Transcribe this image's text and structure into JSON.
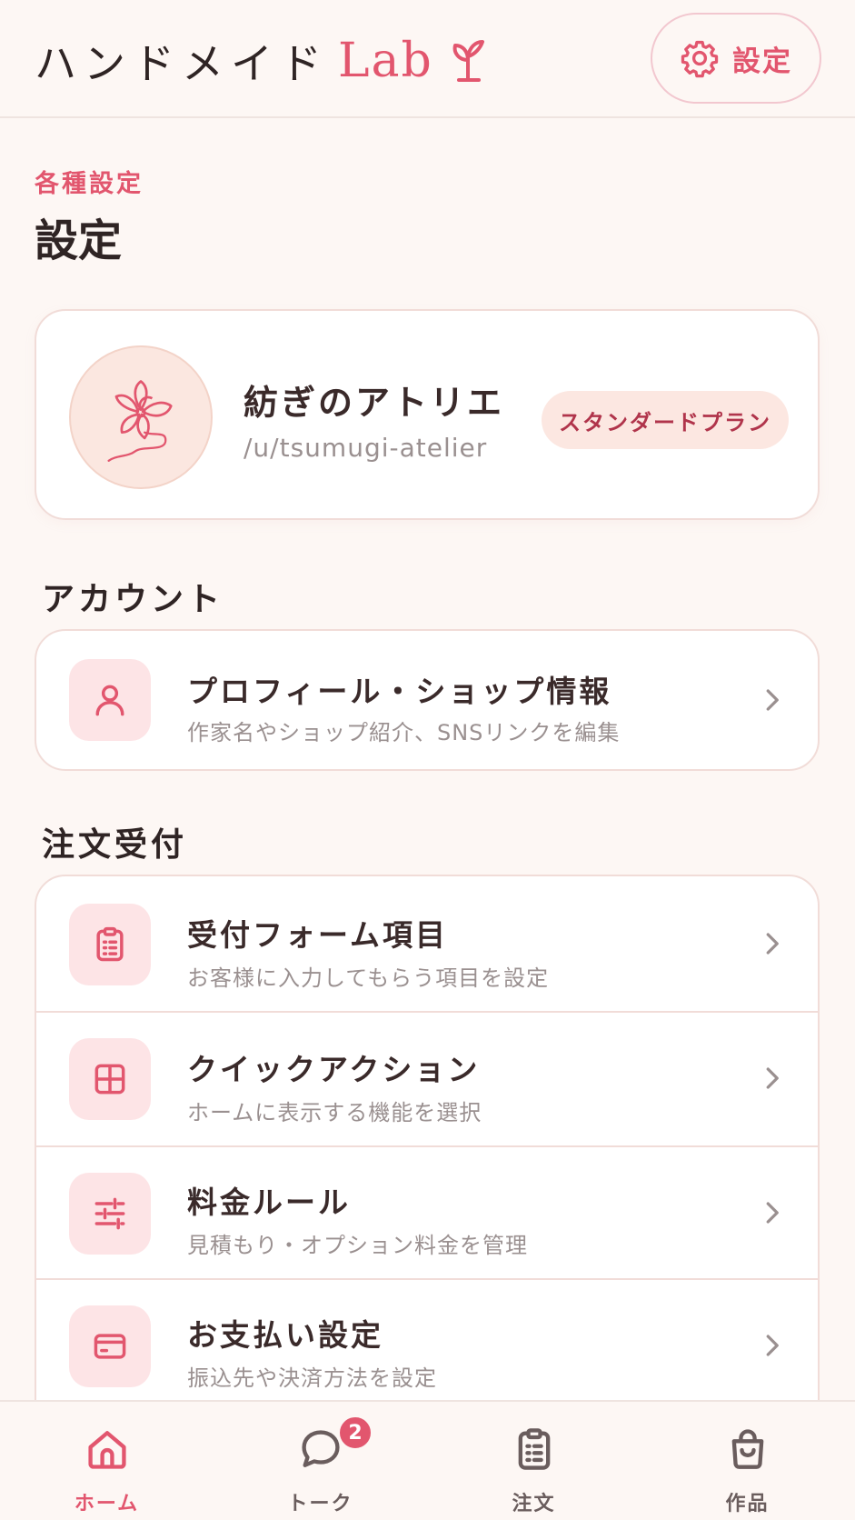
{
  "header": {
    "brand_jp": "ハンドメイド",
    "brand_lab": "Lab",
    "brand_icon": "sprout-icon",
    "settings_label": "設定",
    "settings_icon": "gear-icon"
  },
  "page": {
    "eyebrow": "各種設定",
    "title": "設定"
  },
  "profile": {
    "shop_name": "紡ぎのアトリエ",
    "handle": "/u/tsumugi-atelier",
    "plan": "スタンダードプラン",
    "avatar_icon": "sakura-flower-icon"
  },
  "sections": {
    "account": {
      "label": "アカウント",
      "items": [
        {
          "title": "プロフィール・ショップ情報",
          "subtitle": "作家名やショップ紹介、SNSリンクを編集",
          "icon": "person-icon"
        }
      ]
    },
    "orders": {
      "label": "注文受付",
      "items": [
        {
          "title": "受付フォーム項目",
          "subtitle": "お客様に入力してもらう項目を設定",
          "icon": "clipboard-icon"
        },
        {
          "title": "クイックアクション",
          "subtitle": "ホームに表示する機能を選択",
          "icon": "grid-icon"
        },
        {
          "title": "料金ルール",
          "subtitle": "見積もり・オプション料金を管理",
          "icon": "sliders-icon"
        },
        {
          "title": "お支払い設定",
          "subtitle": "振込先や決済方法を設定",
          "icon": "credit-card-icon"
        }
      ]
    }
  },
  "nav": {
    "items": [
      {
        "label": "ホーム",
        "icon": "home-icon",
        "active": true
      },
      {
        "label": "トーク",
        "icon": "chat-bubble-icon",
        "badge": "2"
      },
      {
        "label": "注文",
        "icon": "clipboard-icon"
      },
      {
        "label": "作品",
        "icon": "shopping-bag-icon"
      }
    ]
  },
  "colors": {
    "accent": "#e2566e",
    "background": "#fdf7f4",
    "card": "#ffffff",
    "border": "#f1dcd8",
    "icon_bg": "#fde4e6",
    "badge_bg": "#fce7e1"
  }
}
